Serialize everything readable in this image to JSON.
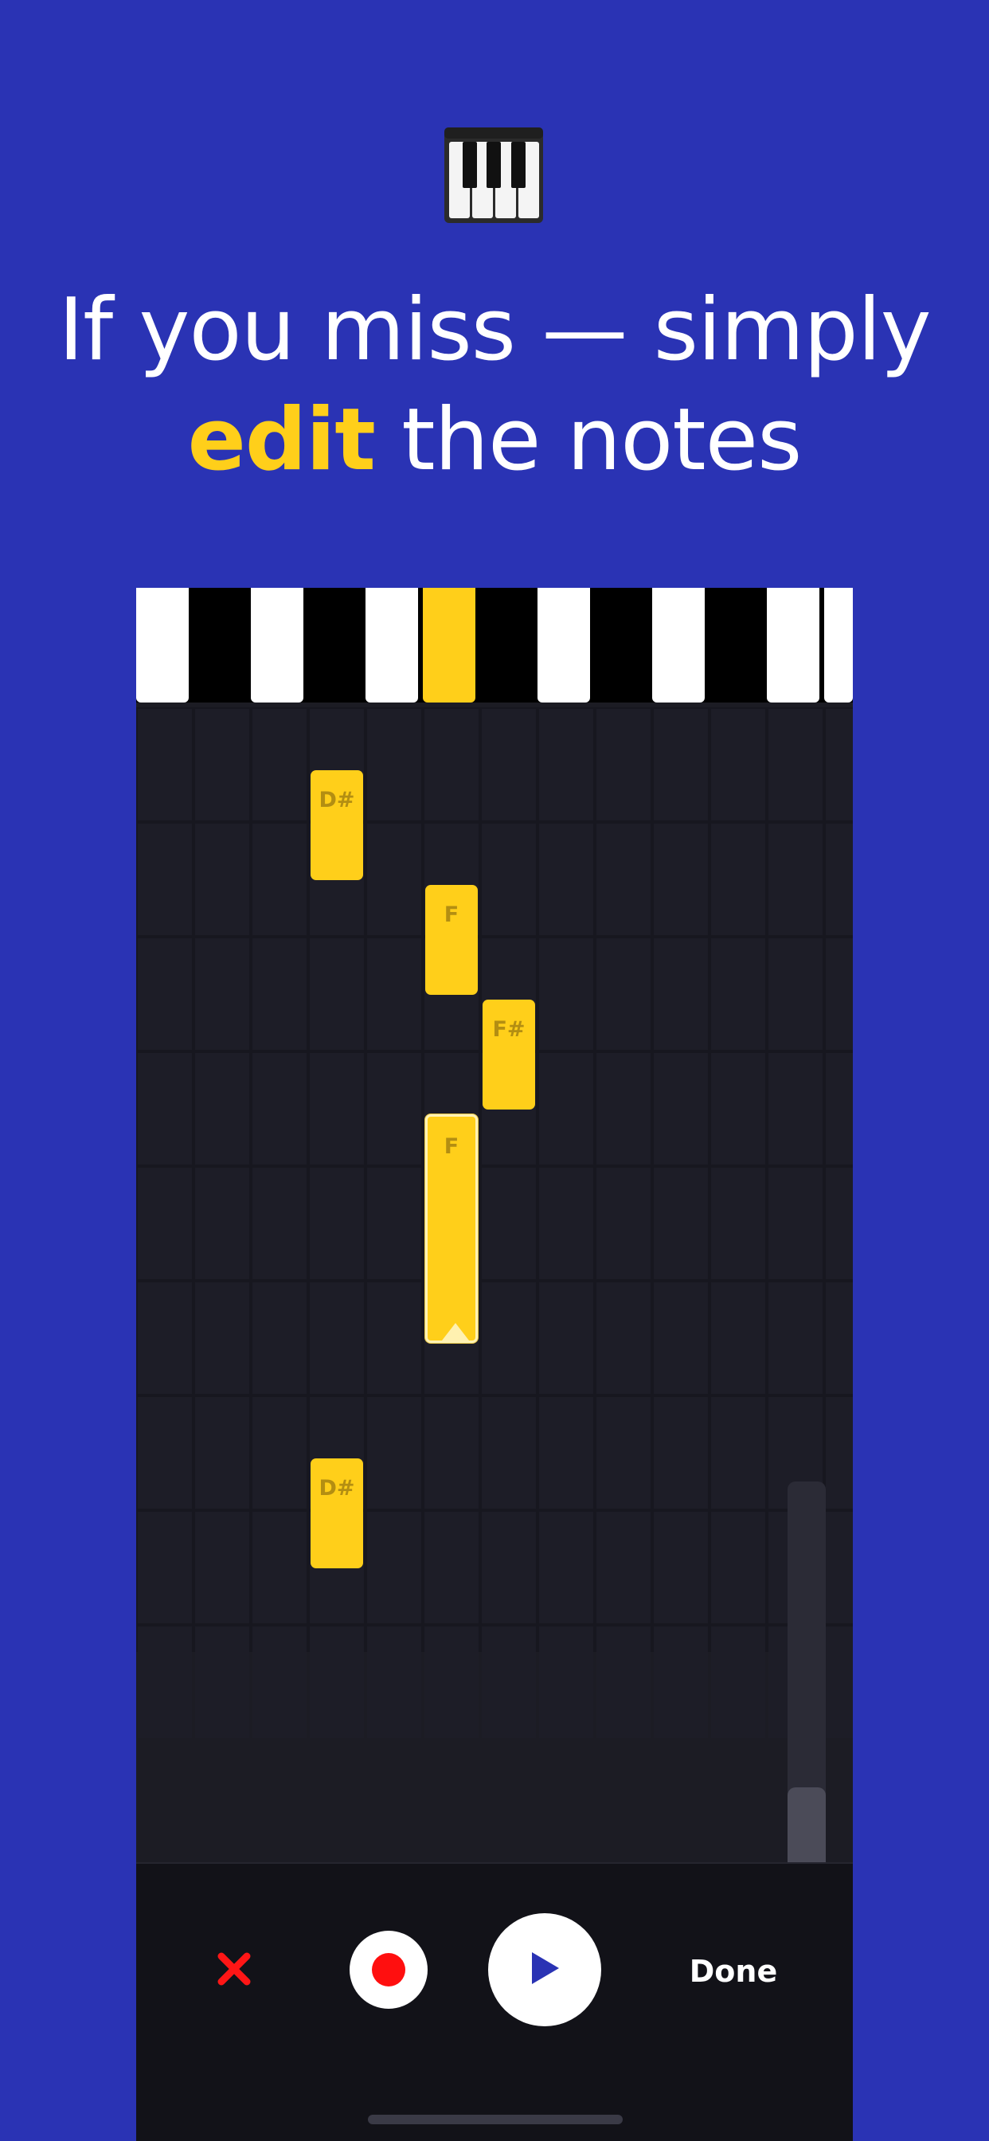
{
  "headline": {
    "line1": "If you miss — simply",
    "highlight": "edit",
    "line2_rest": " the notes"
  },
  "icons": {
    "hero": "piano-keys-icon",
    "cancel": "close-icon",
    "record": "record-icon",
    "play": "play-icon"
  },
  "keyboard": {
    "active_key_index": 5
  },
  "notes": [
    {
      "label": "D#",
      "selected": false
    },
    {
      "label": "F",
      "selected": false
    },
    {
      "label": "F#",
      "selected": false
    },
    {
      "label": "F",
      "selected": true
    },
    {
      "label": "D#",
      "selected": false
    }
  ],
  "toolbar": {
    "done_label": "Done"
  },
  "colors": {
    "background": "#2a33b4",
    "accent": "#ffcf1a",
    "record": "#ff0f0f",
    "play": "#2a33b4"
  }
}
